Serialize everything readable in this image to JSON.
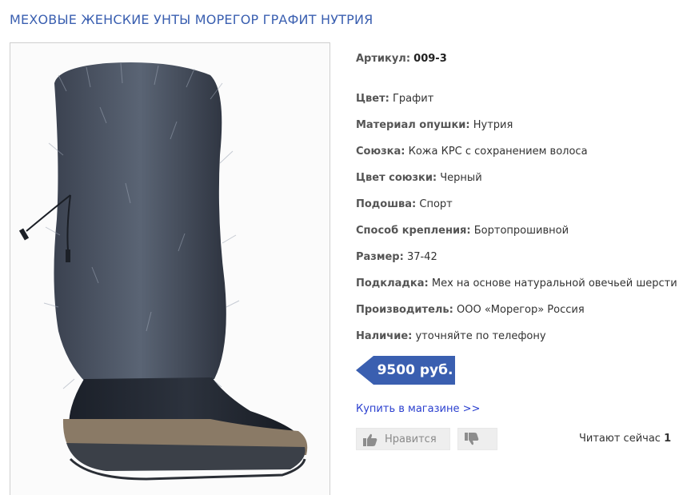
{
  "product": {
    "title": "МЕХОВЫЕ ЖЕНСКИЕ УНТЫ МОРЕГОР ГРАФИТ НУТРИЯ"
  },
  "specs": [
    {
      "label": "Артикул:",
      "value": "009-3"
    },
    {
      "label": "Цвет:",
      "value": "Графит"
    },
    {
      "label": "Материал опушки:",
      "value": "Нутрия"
    },
    {
      "label": "Союзка:",
      "value": "Кожа КРС с сохранением волоса"
    },
    {
      "label": "Цвет союзки:",
      "value": "Черный"
    },
    {
      "label": "Подошва:",
      "value": "Спорт"
    },
    {
      "label": "Способ крепления:",
      "value": "Бортопрошивной"
    },
    {
      "label": "Размер:",
      "value": "37-42"
    },
    {
      "label": "Подкладка:",
      "value": "Мех на основе натуральной овечьей шерсти"
    },
    {
      "label": "Производитель:",
      "value": "ООО «Морегор» Россия"
    },
    {
      "label": "Наличие:",
      "value": "уточняйте по телефону"
    }
  ],
  "price": {
    "text": "9500 руб.",
    "color": "#3a5fb0"
  },
  "buy_link": "Купить в магазине >>",
  "like_label": "Нравится",
  "readers": {
    "label": "Читают сейчас",
    "count": "1"
  },
  "icons": {
    "like": "thumbs-up-icon",
    "dislike": "thumbs-down-icon"
  }
}
